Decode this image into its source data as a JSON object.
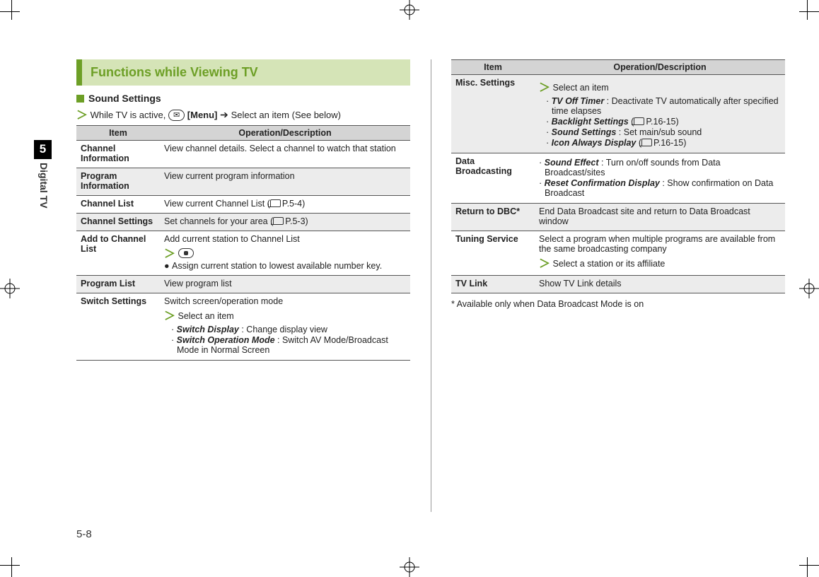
{
  "chapter": {
    "num": "5",
    "label": "Digital TV"
  },
  "section_title": "Functions while Viewing TV",
  "sub_heading": "Sound Settings",
  "intro": {
    "pre": "While TV is active, ",
    "menu": "[Menu]",
    "post": " Select an item (See below)"
  },
  "table_headers": {
    "item": "Item",
    "desc": "Operation/Description"
  },
  "left_rows": [
    {
      "item": "Channel Information",
      "desc_plain": "View channel details. Select a channel to watch that station"
    },
    {
      "item": "Program Information",
      "desc_plain": "View current program information"
    },
    {
      "item": "Channel List",
      "desc_ref": {
        "pre": "View current Channel List (",
        "page": "P.5-4",
        "post": ")"
      }
    },
    {
      "item": "Channel Settings",
      "desc_ref": {
        "pre": "Set channels for your area (",
        "page": "P.5-3",
        "post": ")"
      }
    },
    {
      "item": "Add to Channel List",
      "desc_add": {
        "line1": "Add current station to Channel List",
        "bullet": "Assign current station to lowest available number key."
      }
    },
    {
      "item": "Program List",
      "desc_plain": "View program list"
    },
    {
      "item": "Switch Settings",
      "desc_switch": {
        "line1": "Switch screen/operation mode",
        "select": "Select an item",
        "items": [
          {
            "name": "Switch Display",
            "desc": " : Change display view"
          },
          {
            "name": "Switch Operation Mode",
            "desc": " : Switch AV Mode/Broadcast Mode in Normal Screen"
          }
        ]
      }
    }
  ],
  "right_rows": [
    {
      "item": "Misc. Settings",
      "desc_misc": {
        "select": "Select an item",
        "items": [
          {
            "name": "TV Off Timer",
            "desc": " : Deactivate TV automatically after specified time elapses"
          },
          {
            "name": "Backlight Settings",
            "ref": "P.16-15"
          },
          {
            "name": "Sound Settings",
            "desc": " : Set main/sub sound"
          },
          {
            "name": "Icon Always Display",
            "ref": "P.16-15"
          }
        ]
      }
    },
    {
      "item": "Data Broadcasting",
      "desc_data": {
        "items": [
          {
            "name": "Sound Effect",
            "desc": " : Turn on/off sounds from Data Broadcast/sites"
          },
          {
            "name": "Reset Confirmation Display",
            "desc": " : Show confirmation on Data Broadcast"
          }
        ]
      }
    },
    {
      "item": "Return to DBC*",
      "desc_plain": "End Data Broadcast site and return to Data Broadcast window"
    },
    {
      "item": "Tuning Service",
      "desc_tuning": {
        "line1": "Select a program when multiple programs are available from the same broadcasting company",
        "select": "Select a station or its affiliate"
      }
    },
    {
      "item": "TV Link",
      "desc_plain": "Show TV Link details"
    }
  ],
  "footnote": "* Available only when Data Broadcast Mode is on",
  "page_num": "5-8"
}
